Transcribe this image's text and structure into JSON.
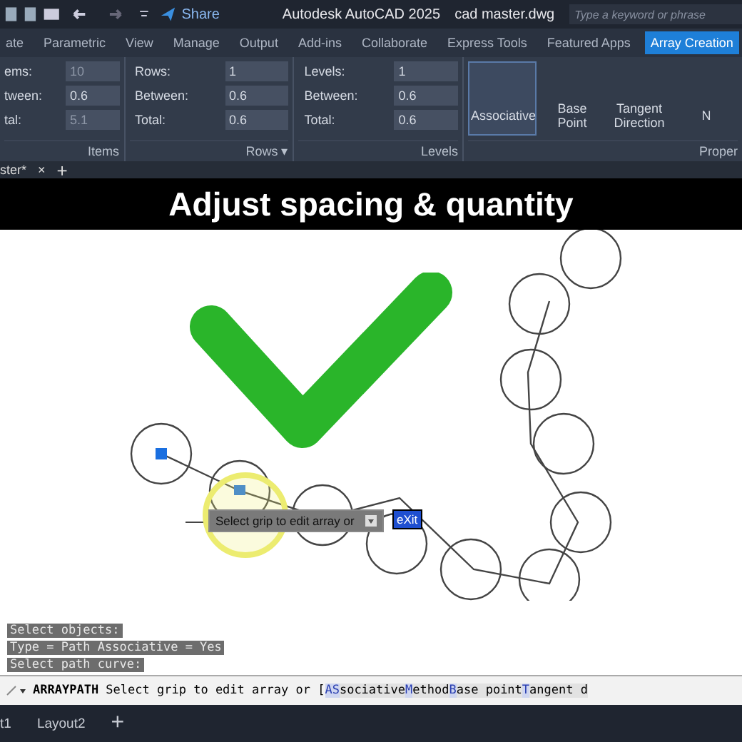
{
  "title_bar": {
    "share": "Share",
    "app": "Autodesk AutoCAD 2025",
    "file": "cad master.dwg",
    "search": {
      "placeholder": "Type a keyword or phrase"
    }
  },
  "tabs": [
    {
      "label": "ate",
      "selected": false
    },
    {
      "label": "Parametric",
      "selected": false
    },
    {
      "label": "View",
      "selected": false
    },
    {
      "label": "Manage",
      "selected": false
    },
    {
      "label": "Output",
      "selected": false
    },
    {
      "label": "Add-ins",
      "selected": false
    },
    {
      "label": "Collaborate",
      "selected": false
    },
    {
      "label": "Express Tools",
      "selected": false
    },
    {
      "label": "Featured Apps",
      "selected": false
    },
    {
      "label": "Array Creation",
      "selected": true
    }
  ],
  "panels": [
    {
      "title": "Items",
      "fields": [
        {
          "label": "ems:",
          "value": "10",
          "disabled": true
        },
        {
          "label": "tween:",
          "value": "0.6",
          "disabled": false
        },
        {
          "label": "tal:",
          "value": "5.1",
          "disabled": true
        }
      ]
    },
    {
      "title": "Rows ▾",
      "fields": [
        {
          "label": "Rows:",
          "value": "1",
          "disabled": false
        },
        {
          "label": "Between:",
          "value": "0.6",
          "disabled": false
        },
        {
          "label": "Total:",
          "value": "0.6",
          "disabled": false
        }
      ]
    },
    {
      "title": "Levels",
      "fields": [
        {
          "label": "Levels:",
          "value": "1",
          "disabled": false
        },
        {
          "label": "Between:",
          "value": "0.6",
          "disabled": false
        },
        {
          "label": "Total:",
          "value": "0.6",
          "disabled": false
        }
      ]
    }
  ],
  "properties": {
    "title": "Proper",
    "buttons": [
      {
        "label": "Associative",
        "selected": true
      },
      {
        "label": "Base Point",
        "selected": false
      },
      {
        "label": "Tangent Direction",
        "selected": false
      },
      {
        "label": "N",
        "selected": false
      }
    ]
  },
  "doc_tab": {
    "label": "ster*",
    "close": "×",
    "add": "+"
  },
  "caption": "Adjust spacing & quantity",
  "canvas": {
    "tooltip": "Select grip to edit array or",
    "input": "eXit"
  },
  "history": [
    "Select objects:",
    "Type = Path  Associative = Yes",
    "Select path curve:"
  ],
  "command_line": {
    "command": "ARRAYPATH",
    "text": "Select grip to edit array or [",
    "options": [
      {
        "key": "AS",
        "rest": "sociative"
      },
      {
        "key": "M",
        "rest": "ethod"
      },
      {
        "key": "B",
        "rest": "ase point"
      },
      {
        "key": "T",
        "rest": "angent d"
      }
    ]
  },
  "layout_tabs": [
    "t1",
    "Layout2",
    "+"
  ]
}
